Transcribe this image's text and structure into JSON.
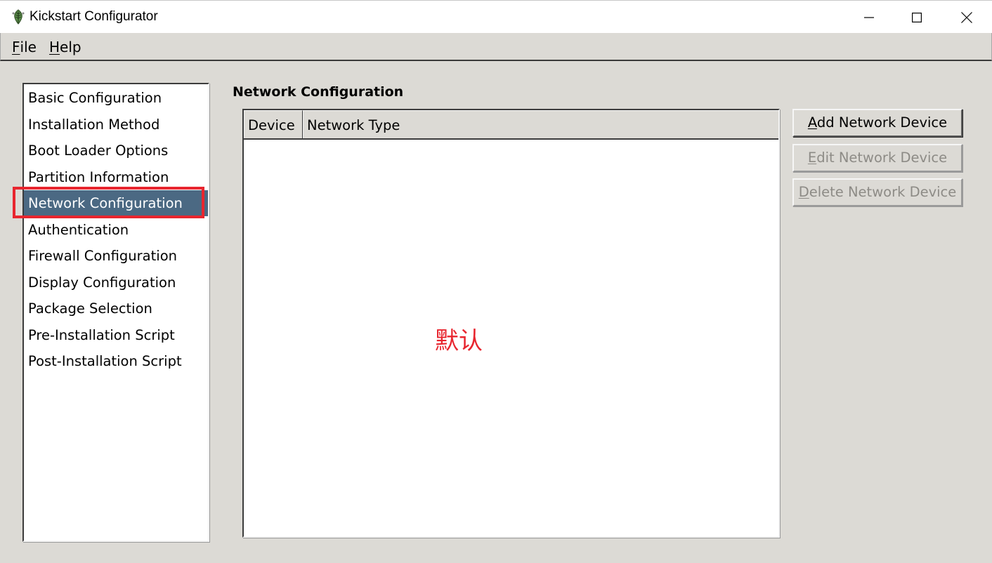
{
  "window": {
    "title": "Kickstart Configurator",
    "icon": "app-icon"
  },
  "menu": {
    "file": {
      "mnemonic": "F",
      "rest": "ile"
    },
    "help": {
      "mnemonic": "H",
      "rest": "elp"
    }
  },
  "sidebar": {
    "selected_index": 4,
    "items": [
      {
        "label": "Basic Configuration"
      },
      {
        "label": "Installation Method"
      },
      {
        "label": "Boot Loader Options"
      },
      {
        "label": "Partition Information"
      },
      {
        "label": "Network Configuration"
      },
      {
        "label": "Authentication"
      },
      {
        "label": "Firewall Configuration"
      },
      {
        "label": "Display Configuration"
      },
      {
        "label": "Package Selection"
      },
      {
        "label": "Pre-Installation Script"
      },
      {
        "label": "Post-Installation Script"
      }
    ]
  },
  "main": {
    "section_title": "Network Configuration",
    "table": {
      "columns": [
        "Device",
        "Network Type"
      ],
      "rows": []
    },
    "overlay_annotation": "默认"
  },
  "buttons": {
    "add": {
      "mnemonic": "A",
      "rest": "dd Network Device",
      "enabled": true
    },
    "edit": {
      "mnemonic": "E",
      "rest": "dit Network Device",
      "enabled": false
    },
    "delete": {
      "mnemonic": "D",
      "rest": "elete Network Device",
      "enabled": false
    }
  },
  "colors": {
    "selection": "#4b6983",
    "annotation_red": "#e8262f",
    "background": "#dcdad5"
  }
}
